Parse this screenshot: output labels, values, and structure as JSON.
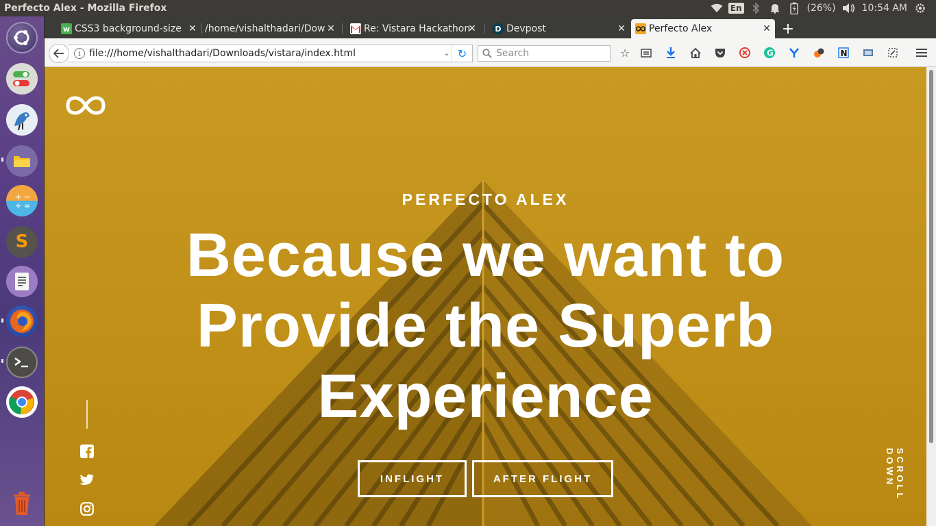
{
  "os": {
    "window_title": "Perfecto Alex - Mozilla Firefox",
    "tray": {
      "language": "En",
      "battery": "(26%)",
      "clock": "10:54 AM"
    },
    "launcher_icons": [
      "ubuntu-dash-icon",
      "settings-toggle-icon",
      "bird-app-icon",
      "files-icon",
      "calculator-icon",
      "sublime-text-icon",
      "text-editor-icon",
      "firefox-icon",
      "terminal-icon",
      "chrome-icon",
      "trash-icon"
    ],
    "colors": {
      "panel": "#3c3b37",
      "launcher": "#5a3f86"
    }
  },
  "browser": {
    "tabs": [
      {
        "label": "CSS3 background-size",
        "icon": "w3-icon"
      },
      {
        "label": "/home/vishalthadari/Dow",
        "icon": "none"
      },
      {
        "label": "Re: Vistara Hackathon",
        "icon": "gmail-icon"
      },
      {
        "label": "Devpost",
        "icon": "devpost-icon"
      },
      {
        "label": "Perfecto Alex",
        "icon": "infinity-icon",
        "active": true
      }
    ],
    "url": "file:///home/vishalthadari/Downloads/vistara/index.html",
    "search_placeholder": "Search"
  },
  "site": {
    "eyebrow": "PERFECTO ALEX",
    "headline_lines": [
      "Because we want to",
      "Provide the Superb",
      "Experience"
    ],
    "buttons": {
      "inflight": "INFLIGHT",
      "after_flight": "AFTER FLIGHT"
    },
    "scroll_hint": "SCROLL DOWN",
    "social_icons": [
      "facebook-icon",
      "twitter-icon",
      "instagram-icon"
    ],
    "colors": {
      "background": "#c8961e",
      "text": "#ffffff"
    }
  }
}
